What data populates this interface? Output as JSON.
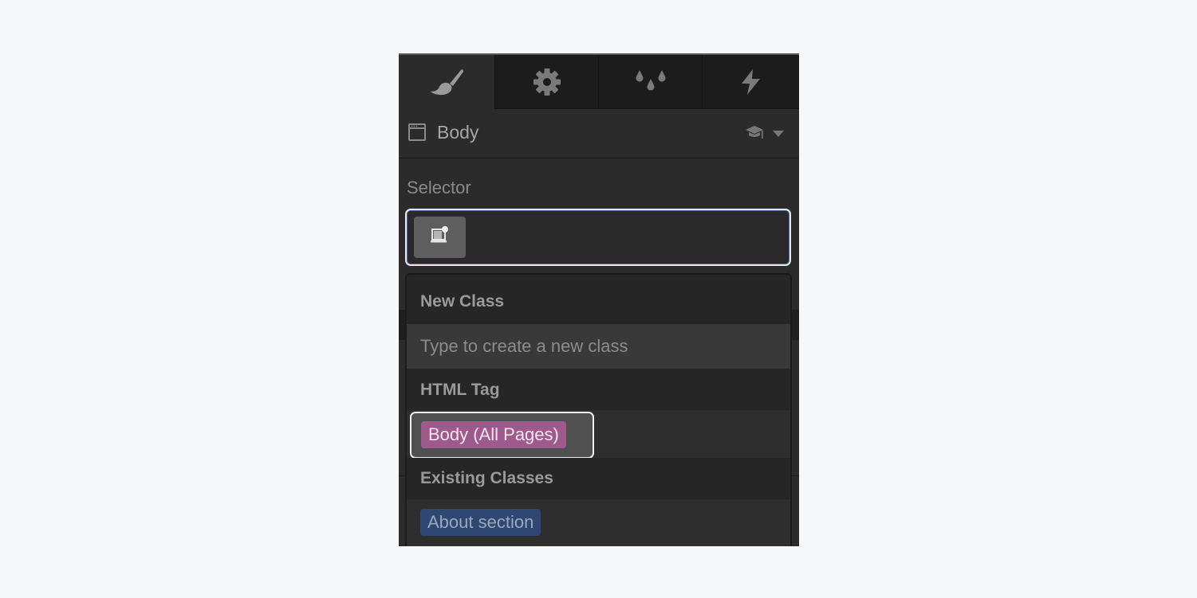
{
  "tabs": [
    {
      "name": "style",
      "icon": "paintbrush-icon",
      "active": true
    },
    {
      "name": "settings",
      "icon": "gear-icon",
      "active": false
    },
    {
      "name": "style-manager",
      "icon": "droplets-icon",
      "active": false
    },
    {
      "name": "interactions",
      "icon": "lightning-icon",
      "active": false
    }
  ],
  "element": {
    "icon": "browser-window-icon",
    "name": "Body",
    "help_icon": "graduation-cap-icon",
    "menu_icon": "caret-down-icon"
  },
  "selector": {
    "label": "Selector",
    "token_icon": "global-body-icon",
    "value": ""
  },
  "dropdown": {
    "new_class_heading": "New Class",
    "new_class_placeholder": "Type to create a new class",
    "html_tag_heading": "HTML Tag",
    "html_tag_item": "Body (All Pages)",
    "existing_heading": "Existing Classes",
    "existing_items": [
      "About section"
    ]
  },
  "colors": {
    "tag_chip": "#9e5a8c",
    "class_chip": "#2f4873",
    "panel_bg": "#2b2b2b",
    "page_bg": "#f6f7f9"
  }
}
